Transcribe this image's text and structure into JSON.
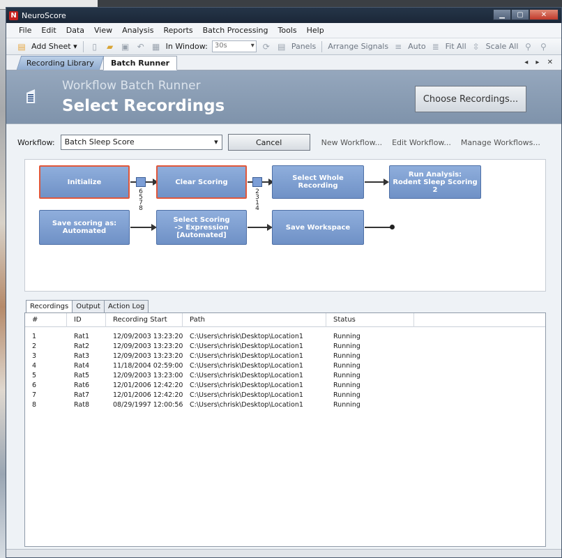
{
  "window": {
    "title": "NeuroScore",
    "app_icon": "N"
  },
  "menu": [
    "File",
    "Edit",
    "Data",
    "View",
    "Analysis",
    "Reports",
    "Batch Processing",
    "Tools",
    "Help"
  ],
  "toolbar": {
    "add_sheet": "Add Sheet ▾",
    "in_window_label": "In Window:",
    "in_window_value": "30s",
    "panels": "Panels",
    "arrange_signals": "Arrange Signals",
    "auto": "Auto",
    "fit_all": "Fit All",
    "scale_all": "Scale All"
  },
  "tabs": {
    "recording_library": "Recording Library",
    "batch_runner": "Batch Runner",
    "nav": "◂ ▸ ✕"
  },
  "header": {
    "subtitle": "Workflow Batch Runner",
    "title": "Select Recordings",
    "choose_button": "Choose Recordings..."
  },
  "workflow": {
    "label": "Workflow:",
    "selected": "Batch Sleep Score",
    "cancel": "Cancel",
    "new_link": "New Workflow...",
    "edit_link": "Edit Workflow...",
    "manage_link": "Manage Workflows..."
  },
  "diagram": {
    "nodes": {
      "initialize": "Initialize",
      "clear_scoring": "Clear Scoring",
      "select_whole": "Select Whole Recording",
      "run_analysis_1": "Run Analysis:",
      "run_analysis_2": "Rodent Sleep Scoring 2",
      "save_scoring_1": "Save scoring as:",
      "save_scoring_2": "Automated",
      "select_scoring_1": "Select Scoring",
      "select_scoring_2": "-> Expression",
      "select_scoring_3": "[Automated]",
      "save_workspace": "Save Workspace"
    },
    "port1_nums": [
      "6",
      "5",
      "7",
      "8"
    ],
    "port2_nums": [
      "2",
      "3",
      "1",
      "4"
    ]
  },
  "lower_tabs": [
    "Recordings",
    "Output",
    "Action Log"
  ],
  "table": {
    "headers": [
      "#",
      "ID",
      "Recording Start",
      "Path",
      "Status",
      ""
    ],
    "rows": [
      [
        "1",
        "Rat1",
        "12/09/2003 13:23:20",
        "C:\\Users\\chrisk\\Desktop\\Location1",
        "Running"
      ],
      [
        "2",
        "Rat2",
        "12/09/2003 13:23:20",
        "C:\\Users\\chrisk\\Desktop\\Location1",
        "Running"
      ],
      [
        "3",
        "Rat3",
        "12/09/2003 13:23:20",
        "C:\\Users\\chrisk\\Desktop\\Location1",
        "Running"
      ],
      [
        "4",
        "Rat4",
        "11/18/2004 02:59:00",
        "C:\\Users\\chrisk\\Desktop\\Location1",
        "Running"
      ],
      [
        "5",
        "Rat5",
        "12/09/2003 13:23:00",
        "C:\\Users\\chrisk\\Desktop\\Location1",
        "Running"
      ],
      [
        "6",
        "Rat6",
        "12/01/2006 12:42:20",
        "C:\\Users\\chrisk\\Desktop\\Location1",
        "Running"
      ],
      [
        "7",
        "Rat7",
        "12/01/2006 12:42:20",
        "C:\\Users\\chrisk\\Desktop\\Location1",
        "Running"
      ],
      [
        "8",
        "Rat8",
        "08/29/1997 12:00:56",
        "C:\\Users\\chrisk\\Desktop\\Location1",
        "Running"
      ]
    ]
  },
  "colors": {
    "node_fill": "#7f9fd2",
    "node_selected_border": "#e0573a",
    "header_band": "#8a9db5"
  }
}
